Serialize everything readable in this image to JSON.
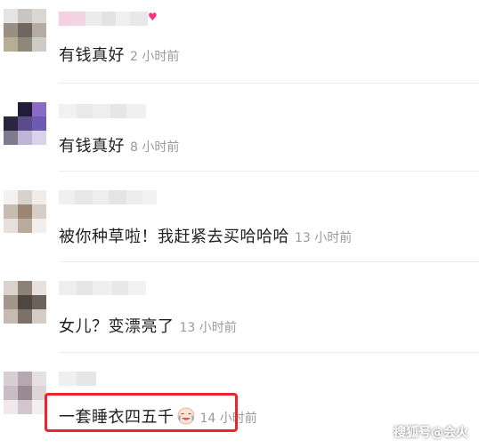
{
  "comments": [
    {
      "text": "有钱真好",
      "time": "2 小时前"
    },
    {
      "text": "有钱真好",
      "time": "8 小时前"
    },
    {
      "text": "被你种草啦！我赶紧去买哈哈哈",
      "time": "13 小时前"
    },
    {
      "text": "女儿？变漂亮了",
      "time": "13 小时前"
    },
    {
      "text": "一套睡衣四五千",
      "time": "14 小时前",
      "emoji": "crying-laughing-emoji"
    }
  ],
  "watermark": "搜狐号@会火",
  "colors": {
    "highlight_border": "#e8262b",
    "text": "#1f1f1f",
    "time": "#9a9a9a",
    "heart": "#ff2e7e"
  }
}
